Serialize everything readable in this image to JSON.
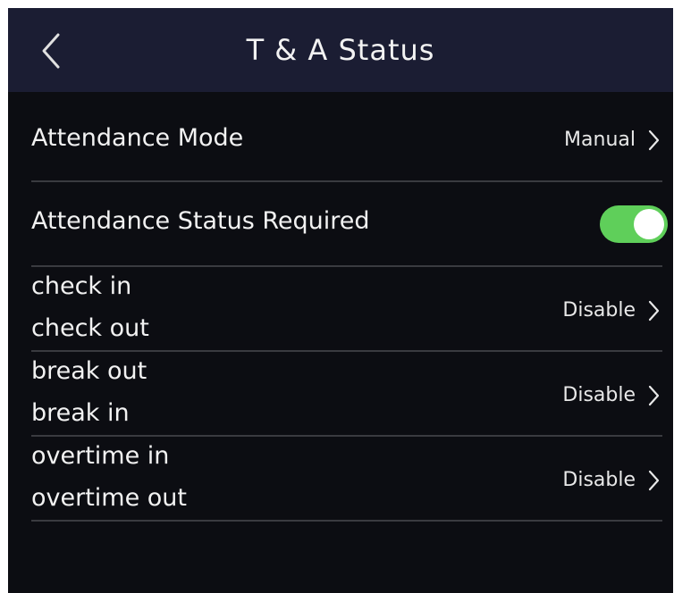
{
  "header": {
    "title": "T & A Status",
    "back_icon": "chevron-left-icon"
  },
  "settings": {
    "attendance_mode": {
      "label": "Attendance Mode",
      "value": "Manual"
    },
    "status_required": {
      "label": "Attendance Status Required",
      "enabled": true,
      "toggle_color": "#5fcf5a"
    },
    "status_rows": [
      {
        "line1": "check in",
        "line2": "check out",
        "value": "Disable"
      },
      {
        "line1": "break out",
        "line2": "break in",
        "value": "Disable"
      },
      {
        "line1": "overtime in",
        "line2": "overtime out",
        "value": "Disable"
      }
    ]
  },
  "colors": {
    "background": "#0c0d12",
    "header": "#1b1d33",
    "divider": "#3a3b40",
    "text": "#f2f2f2"
  }
}
